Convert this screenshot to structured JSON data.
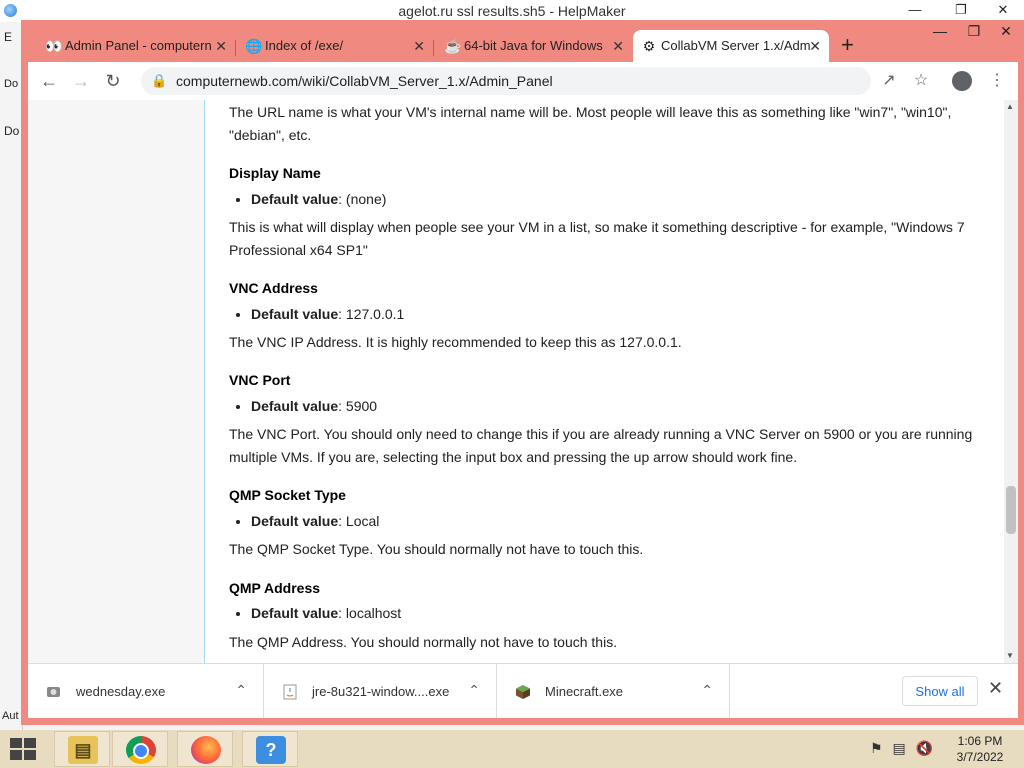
{
  "background_window": {
    "title": "agelot.ru ssl results.sh5 - HelpMaker",
    "left_fragments": [
      "E",
      "Do",
      "Do",
      "Aut"
    ]
  },
  "browser": {
    "tabs": [
      {
        "label": "Admin Panel - computern",
        "icon": "eyes-icon"
      },
      {
        "label": "Index of /exe/",
        "icon": "globe-icon"
      },
      {
        "label": "64-bit Java for Windows",
        "icon": "java-icon"
      },
      {
        "label": "CollabVM Server 1.x/Adm",
        "icon": "collabvm-icon"
      }
    ],
    "url": "computernewb.com/wiki/CollabVM_Server_1.x/Admin_Panel"
  },
  "article": {
    "intro": "The URL name is what your VM's internal name will be. Most people will leave this as something like \"win7\", \"win10\", \"debian\", etc.",
    "default_label": "Default value",
    "sections": [
      {
        "heading": "Display Name",
        "default": ": (none)",
        "desc": "This is what will display when people see your VM in a list, so make it something descriptive - for example, \"Windows 7 Professional x64 SP1\""
      },
      {
        "heading": "VNC Address",
        "default": ": 127.0.0.1",
        "desc": "The VNC IP Address. It is highly recommended to keep this as 127.0.0.1."
      },
      {
        "heading": "VNC Port",
        "default": ": 5900",
        "desc": "The VNC Port. You should only need to change this if you are already running a VNC Server on 5900 or you are running multiple VMs. If you are, selecting the input box and pressing the up arrow should work fine."
      },
      {
        "heading": "QMP Socket Type",
        "default": ": Local",
        "desc": "The QMP Socket Type. You should normally not have to touch this."
      },
      {
        "heading": "QMP Address",
        "default": ": localhost",
        "desc": "The QMP Address. You should normally not have to touch this."
      }
    ]
  },
  "downloads": {
    "items": [
      {
        "name": "wednesday.exe"
      },
      {
        "name": "jre-8u321-window....exe"
      },
      {
        "name": "Minecraft.exe"
      }
    ],
    "show_all": "Show all"
  },
  "taskbar": {
    "time": "1:06 PM",
    "date": "3/7/2022"
  },
  "colors": {
    "chrome_frame": "#f08a80",
    "taskbar": "#e8dcc0"
  }
}
